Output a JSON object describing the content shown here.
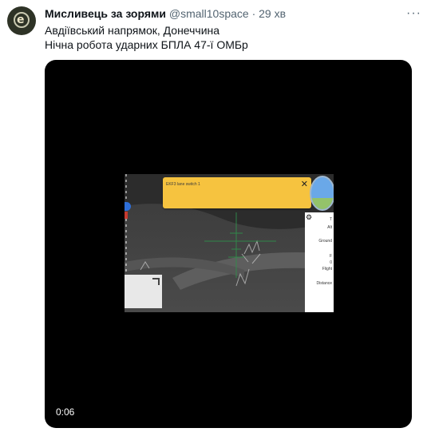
{
  "tweet": {
    "author_name": "Мисливець за зорями",
    "handle": "@small10space",
    "separator": "·",
    "time": "29 хв",
    "more_icon": "more-horizontal-icon",
    "text_line1": "Авдіївський напрямок, Донеччина",
    "text_line2": "Нічна робота ударних БПЛА 47-ї ОМБр"
  },
  "video": {
    "notification": "EKF3 lane switch 1",
    "close_symbol": "✕",
    "panel_labels": [
      "T",
      "Alt",
      "Ground",
      "F",
      "0",
      "Flight",
      "Distance"
    ],
    "timecode": "0:06"
  },
  "colors": {
    "notification_bg": "#f6c33f",
    "reticle": "#2f8f4a",
    "accent": "#536471"
  }
}
